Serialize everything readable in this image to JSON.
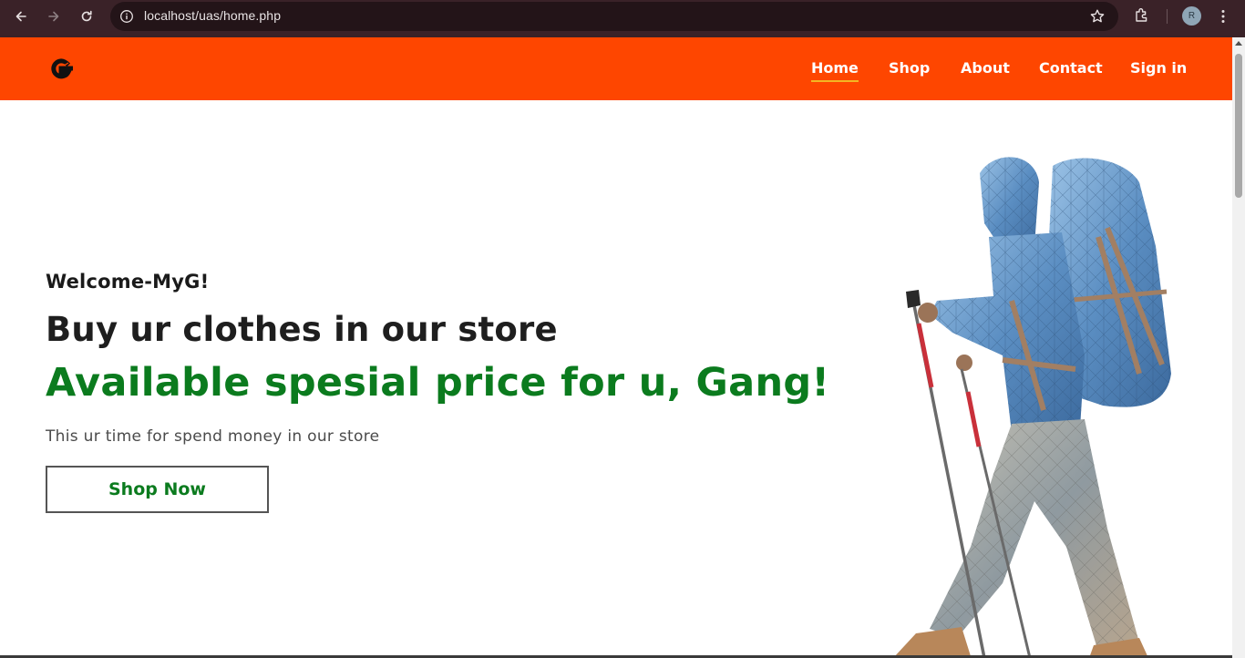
{
  "browser": {
    "url": "localhost/uas/home.php",
    "profile_initial": "R"
  },
  "header": {
    "brand_color": "#fe4600",
    "logo_icon": "g-logo-icon",
    "nav": [
      {
        "label": "Home",
        "active": true
      },
      {
        "label": "Shop",
        "active": false
      },
      {
        "label": "About",
        "active": false
      },
      {
        "label": "Contact",
        "active": false
      },
      {
        "label": "Sign in",
        "active": false
      }
    ]
  },
  "hero": {
    "welcome": "Welcome-MyG!",
    "headline": "Buy ur clothes in our store",
    "subheadline": "Available spesial price for u, Gang!",
    "tagline": "This ur time for spend money in our store",
    "cta_label": "Shop Now",
    "accent_color": "#0b7b1e",
    "image": "hiker-with-backpack-image"
  }
}
